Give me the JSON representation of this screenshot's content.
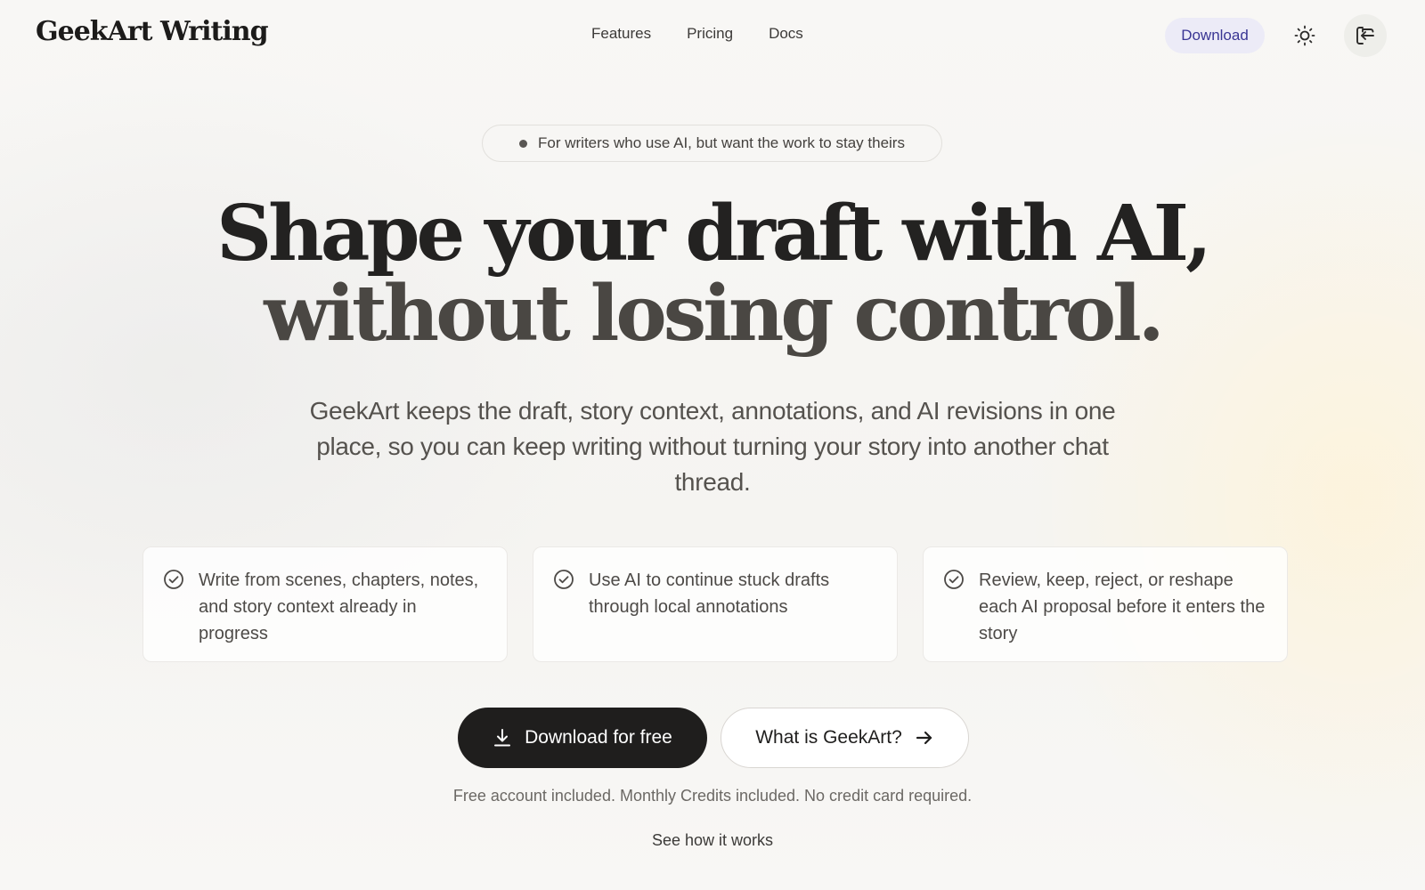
{
  "header": {
    "brand": "GeekArt Writing",
    "nav": [
      {
        "label": "Features"
      },
      {
        "label": "Pricing"
      },
      {
        "label": "Docs"
      }
    ],
    "download_label": "Download",
    "theme_icon": "sun-icon",
    "signin_icon": "sign-in-icon"
  },
  "hero": {
    "eyebrow": "For writers who use AI, but want the work to stay theirs",
    "headline_line1": "Shape your draft with AI,",
    "headline_line2": "without losing control.",
    "subtitle": "GeekArt keeps the draft, story context, annotations, and AI revisions in one place, so you can keep writing without turning your story into another chat thread."
  },
  "features": [
    {
      "icon": "check-circle-icon",
      "text": "Write from scenes, chapters, notes, and story context already in progress"
    },
    {
      "icon": "check-circle-icon",
      "text": "Use AI to continue stuck drafts through local annotations"
    },
    {
      "icon": "check-circle-icon",
      "text": "Review, keep, reject, or reshape each AI proposal before it enters the story"
    }
  ],
  "cta": {
    "primary_label": "Download for free",
    "primary_icon": "download-icon",
    "secondary_label": "What is GeekArt?",
    "secondary_icon": "arrow-right-icon",
    "note": "Free account included. Monthly Credits included. No credit card required.",
    "see_how": "See how it works"
  },
  "colors": {
    "accent_pill_bg": "#ecebf7",
    "accent_pill_text": "#3a3694",
    "primary_button": "#1f1e1d"
  }
}
